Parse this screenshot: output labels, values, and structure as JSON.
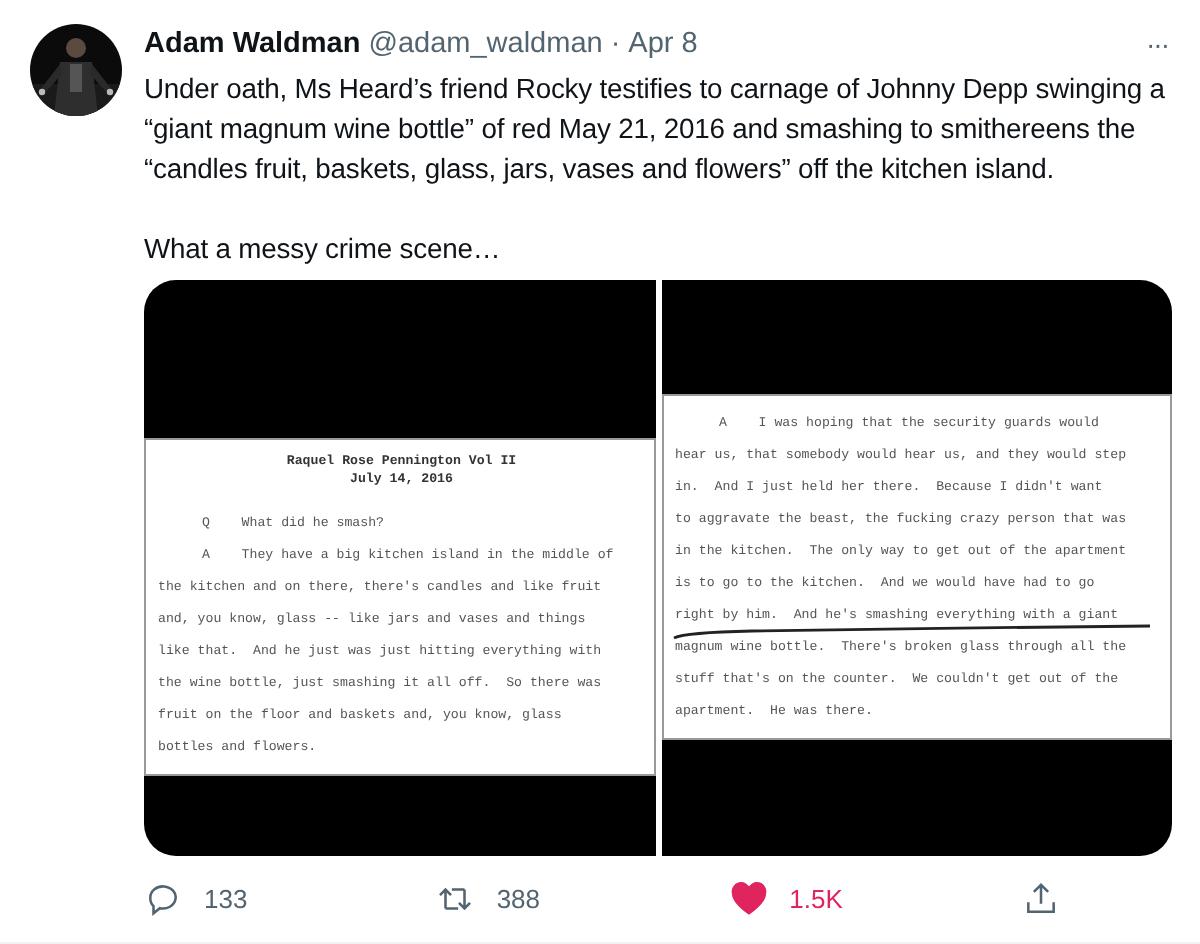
{
  "tweet": {
    "author": "Adam Waldman",
    "handle": "@adam_waldman",
    "separator": "·",
    "date": "Apr 8",
    "more": "···",
    "paragraphs": [
      "Under oath, Ms Heard’s friend Rocky testifies to carnage of Johnny Depp swinging a “giant magnum wine bottle” of red May 21, 2016 and smashing to smithereens the “candles fruit, baskets, glass, jars, vases and flowers” off the kitchen island.",
      "What a messy crime scene…"
    ]
  },
  "media": [
    {
      "kind": "document",
      "title_lines": [
        "Raquel Rose Pennington Vol II",
        "July 14, 2016"
      ],
      "underlined": false,
      "lines": [
        {
          "text": "Q    What did he smash?",
          "indent": true
        },
        {
          "text": "A    They have a big kitchen island in the middle of",
          "indent": true
        },
        {
          "text": "the kitchen and on there, there's candles and like fruit",
          "indent": false
        },
        {
          "text": "and, you know, glass -- like jars and vases and things",
          "indent": false
        },
        {
          "text": "like that.  And he just was just hitting everything with",
          "indent": false
        },
        {
          "text": "the wine bottle, just smashing it all off.  So there was",
          "indent": false
        },
        {
          "text": "fruit on the floor and baskets and, you know, glass",
          "indent": false
        },
        {
          "text": "bottles and flowers.",
          "indent": false
        }
      ]
    },
    {
      "kind": "document",
      "underlined": true,
      "lines": [
        {
          "text": "A    I was hoping that the security guards would",
          "indent": true
        },
        {
          "text": "hear us, that somebody would hear us, and they would step",
          "indent": false
        },
        {
          "text": "in.  And I just held her there.  Because I didn't want",
          "indent": false
        },
        {
          "text": "to aggravate the beast, the fucking crazy person that was",
          "indent": false
        },
        {
          "text": "in the kitchen.  The only way to get out of the apartment",
          "indent": false
        },
        {
          "text": "is to go to the kitchen.  And we would have had to go",
          "indent": false
        },
        {
          "text": "right by him.  And he's smashing everything with a giant",
          "indent": false
        },
        {
          "text": "magnum wine bottle.  There's broken glass through all the",
          "indent": false
        },
        {
          "text": "stuff that's on the counter.  We couldn't get out of the",
          "indent": false
        },
        {
          "text": "apartment.  He was there.",
          "indent": false
        }
      ]
    }
  ],
  "actions": [
    {
      "kind": "reply",
      "count": "133"
    },
    {
      "kind": "retweet",
      "count": "388"
    },
    {
      "kind": "like",
      "count": "1.5K",
      "on": true
    },
    {
      "kind": "share"
    }
  ]
}
